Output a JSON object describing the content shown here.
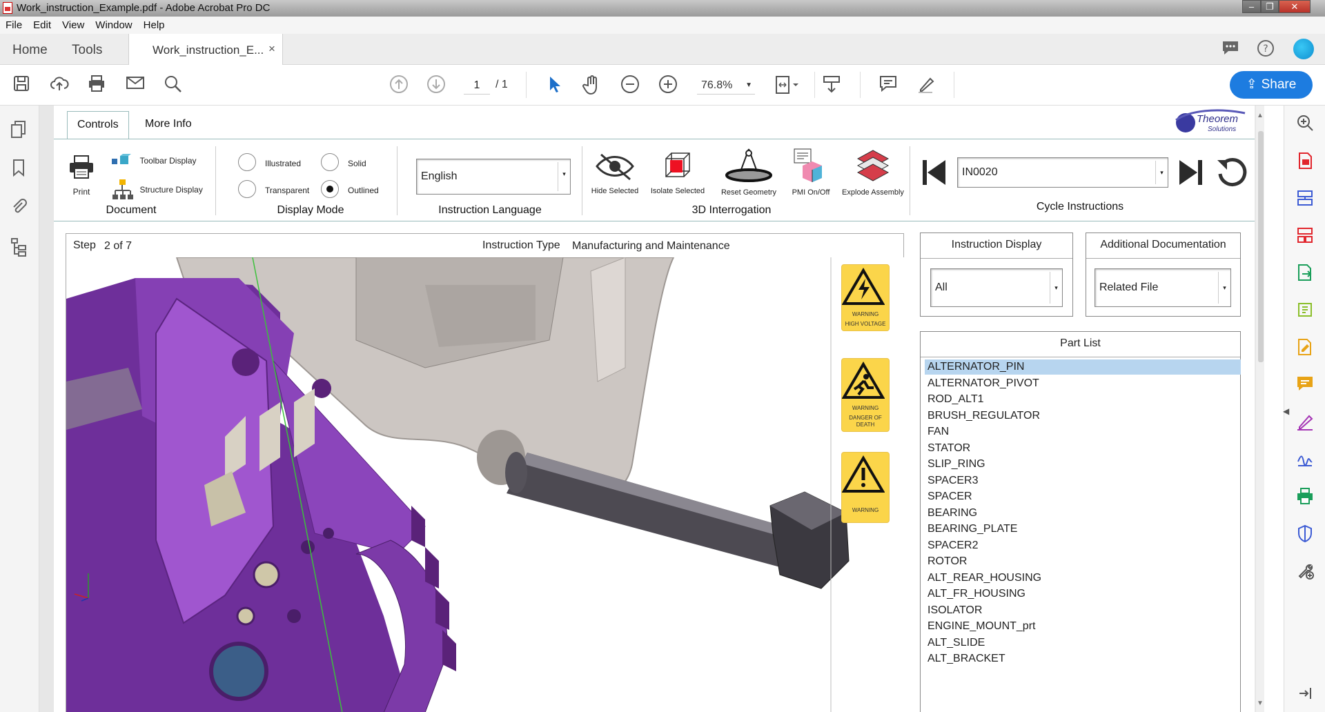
{
  "window": {
    "title": "Work_instruction_Example.pdf - Adobe Acrobat Pro DC"
  },
  "menu": [
    "File",
    "Edit",
    "View",
    "Window",
    "Help"
  ],
  "tabs": {
    "home": "Home",
    "tools": "Tools",
    "document": "Work_instruction_E...",
    "close": "×"
  },
  "toolbar": {
    "page_current": "1",
    "page_total": "/ 1",
    "zoom": "76.8%",
    "share": "Share"
  },
  "controls": {
    "tabs": [
      "Controls",
      "More Info"
    ],
    "document": {
      "print": "Print",
      "toolbar_display": "Toolbar Display",
      "structure_display": "Structure Display",
      "label": "Document"
    },
    "display_mode": {
      "label": "Display Mode",
      "illustrated": "Illustrated",
      "solid": "Solid",
      "transparent": "Transparent",
      "outlined": "Outlined",
      "selected": "Outlined"
    },
    "language": {
      "label": "Instruction Language",
      "value": "English"
    },
    "interrogation": {
      "label": "3D Interrogation",
      "hide": "Hide Selected",
      "isolate": "Isolate Selected",
      "reset": "Reset Geometry",
      "pmi": "PMI On/Off",
      "explode": "Explode Assembly"
    },
    "cycle": {
      "label": "Cycle Instructions",
      "value": "IN0020"
    },
    "logo": {
      "line1": "Theorem",
      "line2": "Solutions"
    }
  },
  "step": {
    "label": "Step",
    "value": "2 of 7",
    "type_label": "Instruction Type",
    "type_value": "Manufacturing and Maintenance"
  },
  "warnings": [
    {
      "text1": "WARNING",
      "text2": "HIGH VOLTAGE",
      "text3": ""
    },
    {
      "text1": "WARNING",
      "text2": "DANGER OF",
      "text3": "DEATH"
    },
    {
      "text1": "WARNING",
      "text2": "",
      "text3": ""
    }
  ],
  "instruction_display": {
    "title": "Instruction Display",
    "value": "All"
  },
  "additional_documentation": {
    "title": "Additional Documentation",
    "value": "Related File"
  },
  "part_list": {
    "title": "Part List",
    "selected": 0,
    "items": [
      "ALTERNATOR_PIN",
      "ALTERNATOR_PIVOT",
      "ROD_ALT1",
      "BRUSH_REGULATOR",
      "FAN",
      "STATOR",
      "SLIP_RING",
      "SPACER3",
      "SPACER",
      "BEARING",
      "BEARING_PLATE",
      "SPACER2",
      "ROTOR",
      "ALT_REAR_HOUSING",
      "ALT_FR_HOUSING",
      "ISOLATOR",
      "ENGINE_MOUNT_prt",
      "ALT_SLIDE",
      "ALT_BRACKET"
    ]
  },
  "colors": {
    "accent": "#1d7ce0",
    "selection": "#b7d5ef",
    "part_purple": "#7a3aa8",
    "warning_yellow": "#fbd54a"
  }
}
